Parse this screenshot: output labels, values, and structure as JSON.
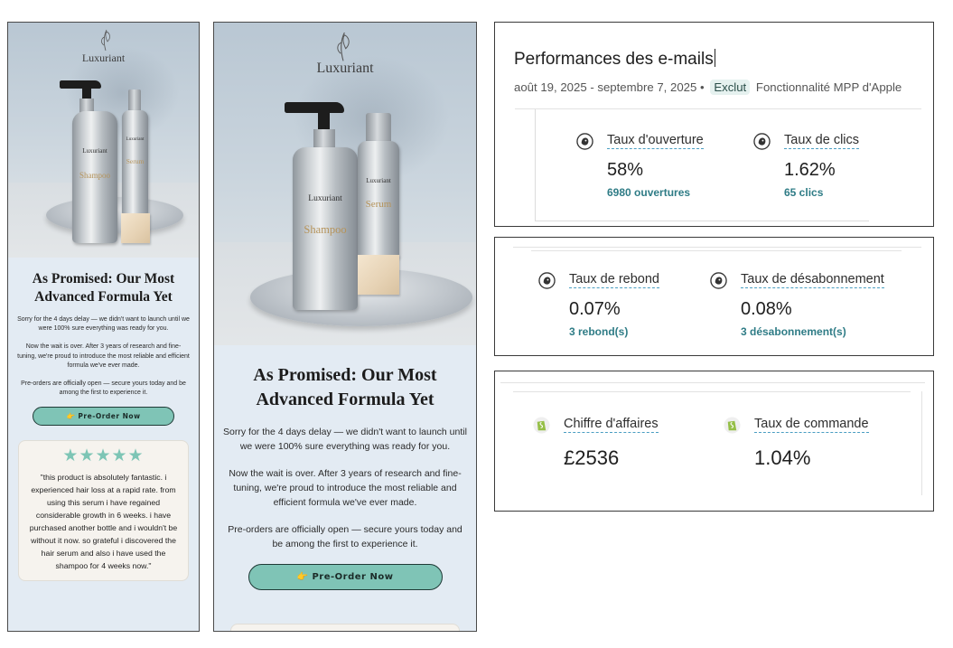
{
  "email_compact": {
    "brand": "Luxuriant",
    "bottle_brand": "Luxuriant",
    "product_left": "Shampoo",
    "product_right": "Serum",
    "headline_line1": "As Promised: Our Most",
    "headline_line2": "Advanced Formula Yet",
    "para1": "Sorry for the 4 days delay — we didn't want to launch until we were 100% sure everything was ready for you.",
    "para2": "Now the wait is over. After 3 years of research and fine-tuning, we're proud to introduce the most reliable and efficient formula we've ever made.",
    "para3": "Pre-orders are officially open — secure yours today and be among the first to experience it.",
    "cta": "👉 Pre-Order Now",
    "stars": "★★★★★",
    "rating": 5,
    "review": "\"this product is absolutely fantastic. i experienced hair loss at a rapid rate. from using this serum i have regained considerable growth in 6 weeks. i have purchased another bottle and i wouldn't be without it now. so grateful i discovered the hair serum and also i have used the shampoo for 4 weeks now.\""
  },
  "email_wide": {
    "brand": "Luxuriant",
    "bottle_brand": "Luxuriant",
    "product_left": "Shampoo",
    "product_right": "Serum",
    "headline_line1": "As Promised: Our Most",
    "headline_line2": "Advanced Formula Yet",
    "para1": "Sorry for the 4 days delay — we didn't want to launch until we were 100% sure everything was ready for you.",
    "para2": "Now the wait is over. After 3 years of research and fine-tuning, we're proud to introduce the most reliable and efficient formula we've ever made.",
    "para3": "Pre-orders are officially open — secure yours today and be among the first to experience it.",
    "cta": "👉 Pre-Order Now"
  },
  "dashboard": {
    "title": "Performances des e-mails",
    "date_range": "août 19, 2025 - septembre 7, 2025 •",
    "badge": "Exclut",
    "mpp_note": "Fonctionnalité MPP d'Apple",
    "colors": {
      "detail": "#2f7c86",
      "underline": "#4a9ec2",
      "cta": "#7fc4b6"
    },
    "metrics_top": [
      {
        "label": "Taux d'ouverture",
        "value": "58%",
        "detail": "6980 ouvertures",
        "icon": "mailchimp-icon"
      },
      {
        "label": "Taux de clics",
        "value": "1.62%",
        "detail": "65 clics",
        "icon": "mailchimp-icon"
      }
    ],
    "metrics_mid": [
      {
        "label": "Taux de rebond",
        "value": "0.07%",
        "detail": "3 rebond(s)",
        "icon": "mailchimp-icon"
      },
      {
        "label": "Taux de désabonnement",
        "value": "0.08%",
        "detail": "3 désabonnement(s)",
        "icon": "mailchimp-icon"
      }
    ],
    "metrics_bottom": [
      {
        "label": "Chiffre d'affaires",
        "value": "£2536",
        "icon": "shopify-icon"
      },
      {
        "label": "Taux de commande",
        "value": "1.04%",
        "icon": "shopify-icon"
      }
    ]
  }
}
